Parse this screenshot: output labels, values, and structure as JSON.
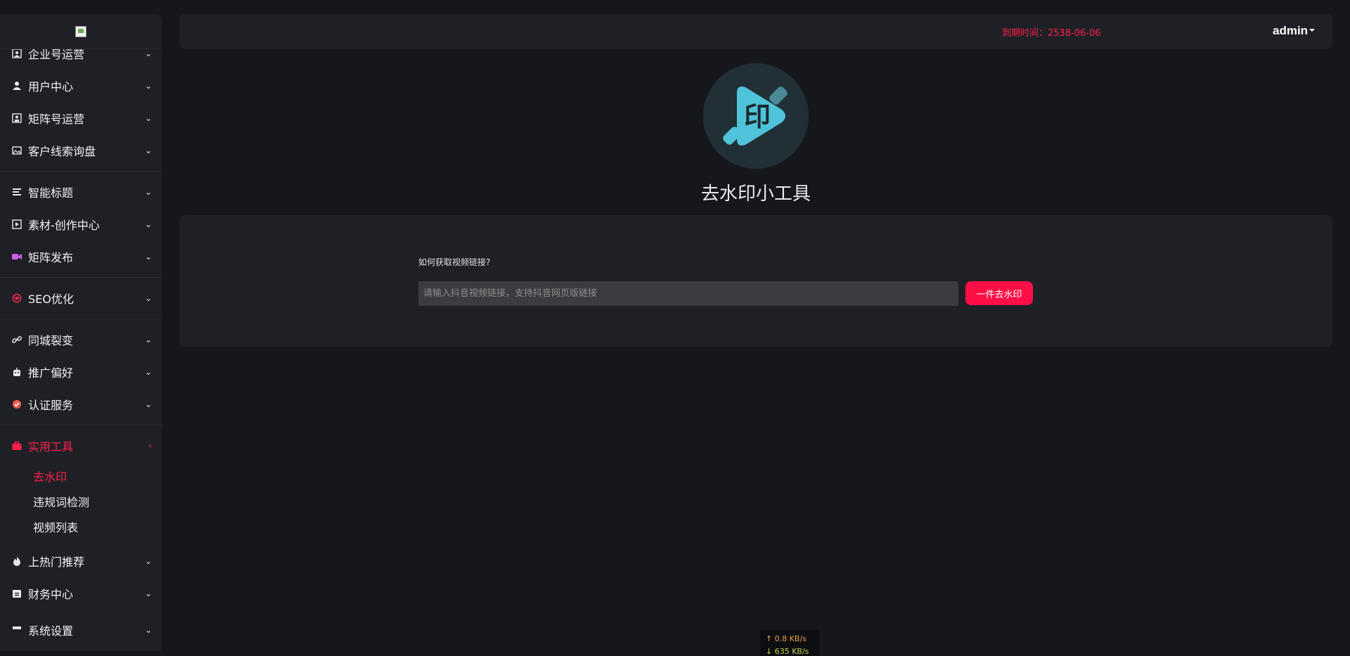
{
  "sidebar": {
    "items": [
      {
        "label": "企业号运营",
        "icon": "enterprise-icon"
      },
      {
        "label": "用户中心",
        "icon": "user-icon"
      },
      {
        "label": "矩阵号运营",
        "icon": "matrix-account-icon"
      },
      {
        "label": "客户线索询盘",
        "icon": "image-gallery-icon"
      },
      {
        "label": "智能标题",
        "icon": "title-icon"
      },
      {
        "label": "素材-创作中心",
        "icon": "film-icon"
      },
      {
        "label": "矩阵发布",
        "icon": "video-camera-icon"
      },
      {
        "label": "SEO优化",
        "icon": "seo-icon"
      },
      {
        "label": "同城裂变",
        "icon": "link-icon"
      },
      {
        "label": "推广偏好",
        "icon": "robot-icon"
      },
      {
        "label": "认证服务",
        "icon": "certificate-icon"
      },
      {
        "label": "实用工具",
        "icon": "toolbox-icon"
      },
      {
        "label": "上热门推荐",
        "icon": "fire-icon"
      },
      {
        "label": "财务中心",
        "icon": "finance-icon"
      },
      {
        "label": "系统设置",
        "icon": "settings-icon"
      }
    ],
    "submenu": [
      {
        "label": "去水印"
      },
      {
        "label": "违规词检测"
      },
      {
        "label": "视频列表"
      }
    ]
  },
  "header": {
    "expire_text": "到期时间：2538-06-06",
    "user": "admin"
  },
  "tool": {
    "logo_char": "印",
    "title": "去水印小工具",
    "help_text": "如何获取视频链接?",
    "input_placeholder": "请输入抖音视频链接，支持抖音网页版链接",
    "submit_label": "一件去水印"
  },
  "network": {
    "up": "↑ 0.8 KB/s",
    "down": "↓ 635 KB/s"
  },
  "colors": {
    "accent": "#ff0f45",
    "background": "#16171c",
    "panel": "#1f2026",
    "logo_bg": "#213036",
    "logo_cyan": "#4fc3d9"
  }
}
